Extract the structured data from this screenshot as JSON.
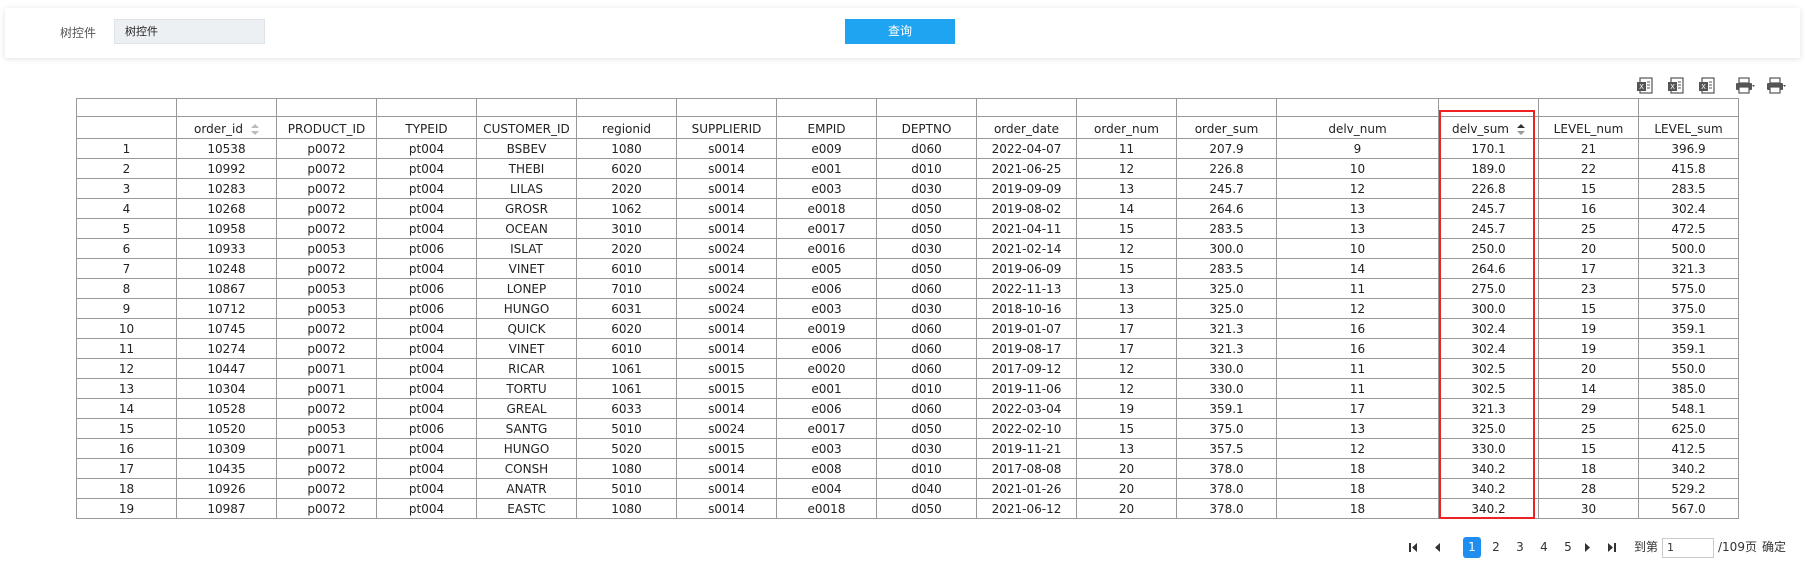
{
  "filter": {
    "label": "树控件",
    "input_value": "树控件",
    "query_button": "查询"
  },
  "toolbar": {
    "icons": [
      "export-excel-icon",
      "export-excel-alt-icon",
      "export-excel-page-icon",
      "print-icon",
      "print-setup-icon"
    ]
  },
  "table": {
    "headers": [
      "",
      "order_id",
      "PRODUCT_ID",
      "TYPEID",
      "CUSTOMER_ID",
      "regionid",
      "SUPPLIERID",
      "EMPID",
      "DEPTNO",
      "order_date",
      "order_num",
      "order_sum",
      "delv_num",
      "delv_sum",
      "LEVEL_num",
      "LEVEL_sum"
    ],
    "sortable_columns": [
      "order_id",
      "delv_sum"
    ],
    "active_sort_column": "delv_sum",
    "rows": [
      [
        "1",
        "10538",
        "p0072",
        "pt004",
        "BSBEV",
        "1080",
        "s0014",
        "e009",
        "d060",
        "2022-04-07",
        "11",
        "207.9",
        "9",
        "170.1",
        "21",
        "396.9"
      ],
      [
        "2",
        "10992",
        "p0072",
        "pt004",
        "THEBI",
        "6020",
        "s0014",
        "e001",
        "d010",
        "2021-06-25",
        "12",
        "226.8",
        "10",
        "189.0",
        "22",
        "415.8"
      ],
      [
        "3",
        "10283",
        "p0072",
        "pt004",
        "LILAS",
        "2020",
        "s0014",
        "e003",
        "d030",
        "2019-09-09",
        "13",
        "245.7",
        "12",
        "226.8",
        "15",
        "283.5"
      ],
      [
        "4",
        "10268",
        "p0072",
        "pt004",
        "GROSR",
        "1062",
        "s0014",
        "e0018",
        "d050",
        "2019-08-02",
        "14",
        "264.6",
        "13",
        "245.7",
        "16",
        "302.4"
      ],
      [
        "5",
        "10958",
        "p0072",
        "pt004",
        "OCEAN",
        "3010",
        "s0014",
        "e0017",
        "d050",
        "2021-04-11",
        "15",
        "283.5",
        "13",
        "245.7",
        "25",
        "472.5"
      ],
      [
        "6",
        "10933",
        "p0053",
        "pt006",
        "ISLAT",
        "2020",
        "s0024",
        "e0016",
        "d030",
        "2021-02-14",
        "12",
        "300.0",
        "10",
        "250.0",
        "20",
        "500.0"
      ],
      [
        "7",
        "10248",
        "p0072",
        "pt004",
        "VINET",
        "6010",
        "s0014",
        "e005",
        "d050",
        "2019-06-09",
        "15",
        "283.5",
        "14",
        "264.6",
        "17",
        "321.3"
      ],
      [
        "8",
        "10867",
        "p0053",
        "pt006",
        "LONEP",
        "7010",
        "s0024",
        "e006",
        "d060",
        "2022-11-13",
        "13",
        "325.0",
        "11",
        "275.0",
        "23",
        "575.0"
      ],
      [
        "9",
        "10712",
        "p0053",
        "pt006",
        "HUNGO",
        "6031",
        "s0024",
        "e003",
        "d030",
        "2018-10-16",
        "13",
        "325.0",
        "12",
        "300.0",
        "15",
        "375.0"
      ],
      [
        "10",
        "10745",
        "p0072",
        "pt004",
        "QUICK",
        "6020",
        "s0014",
        "e0019",
        "d060",
        "2019-01-07",
        "17",
        "321.3",
        "16",
        "302.4",
        "19",
        "359.1"
      ],
      [
        "11",
        "10274",
        "p0072",
        "pt004",
        "VINET",
        "6010",
        "s0014",
        "e006",
        "d060",
        "2019-08-17",
        "17",
        "321.3",
        "16",
        "302.4",
        "19",
        "359.1"
      ],
      [
        "12",
        "10447",
        "p0071",
        "pt004",
        "RICAR",
        "1061",
        "s0015",
        "e0020",
        "d060",
        "2017-09-12",
        "12",
        "330.0",
        "11",
        "302.5",
        "20",
        "550.0"
      ],
      [
        "13",
        "10304",
        "p0071",
        "pt004",
        "TORTU",
        "1061",
        "s0015",
        "e001",
        "d010",
        "2019-11-06",
        "12",
        "330.0",
        "11",
        "302.5",
        "14",
        "385.0"
      ],
      [
        "14",
        "10528",
        "p0072",
        "pt004",
        "GREAL",
        "6033",
        "s0014",
        "e006",
        "d060",
        "2022-03-04",
        "19",
        "359.1",
        "17",
        "321.3",
        "29",
        "548.1"
      ],
      [
        "15",
        "10520",
        "p0053",
        "pt006",
        "SANTG",
        "5010",
        "s0024",
        "e0017",
        "d050",
        "2022-02-10",
        "15",
        "375.0",
        "13",
        "325.0",
        "25",
        "625.0"
      ],
      [
        "16",
        "10309",
        "p0071",
        "pt004",
        "HUNGO",
        "5020",
        "s0015",
        "e003",
        "d030",
        "2019-11-21",
        "13",
        "357.5",
        "12",
        "330.0",
        "15",
        "412.5"
      ],
      [
        "17",
        "10435",
        "p0072",
        "pt004",
        "CONSH",
        "1080",
        "s0014",
        "e008",
        "d010",
        "2017-08-08",
        "20",
        "378.0",
        "18",
        "340.2",
        "18",
        "340.2"
      ],
      [
        "18",
        "10926",
        "p0072",
        "pt004",
        "ANATR",
        "5010",
        "s0014",
        "e004",
        "d040",
        "2021-01-26",
        "20",
        "378.0",
        "18",
        "340.2",
        "28",
        "529.2"
      ],
      [
        "19",
        "10987",
        "p0072",
        "pt004",
        "EASTC",
        "1080",
        "s0014",
        "e0018",
        "d050",
        "2021-06-12",
        "20",
        "378.0",
        "18",
        "340.2",
        "30",
        "567.0"
      ]
    ]
  },
  "pager": {
    "pages": [
      "1",
      "2",
      "3",
      "4",
      "5"
    ],
    "current_page": "1",
    "goto_label": "到第",
    "goto_value": "1",
    "total_label": "/109页",
    "confirm_label": "确定"
  },
  "colors": {
    "accent": "#1fa4f2",
    "pager_active": "#1f8ef1",
    "highlight": "#e22222"
  }
}
